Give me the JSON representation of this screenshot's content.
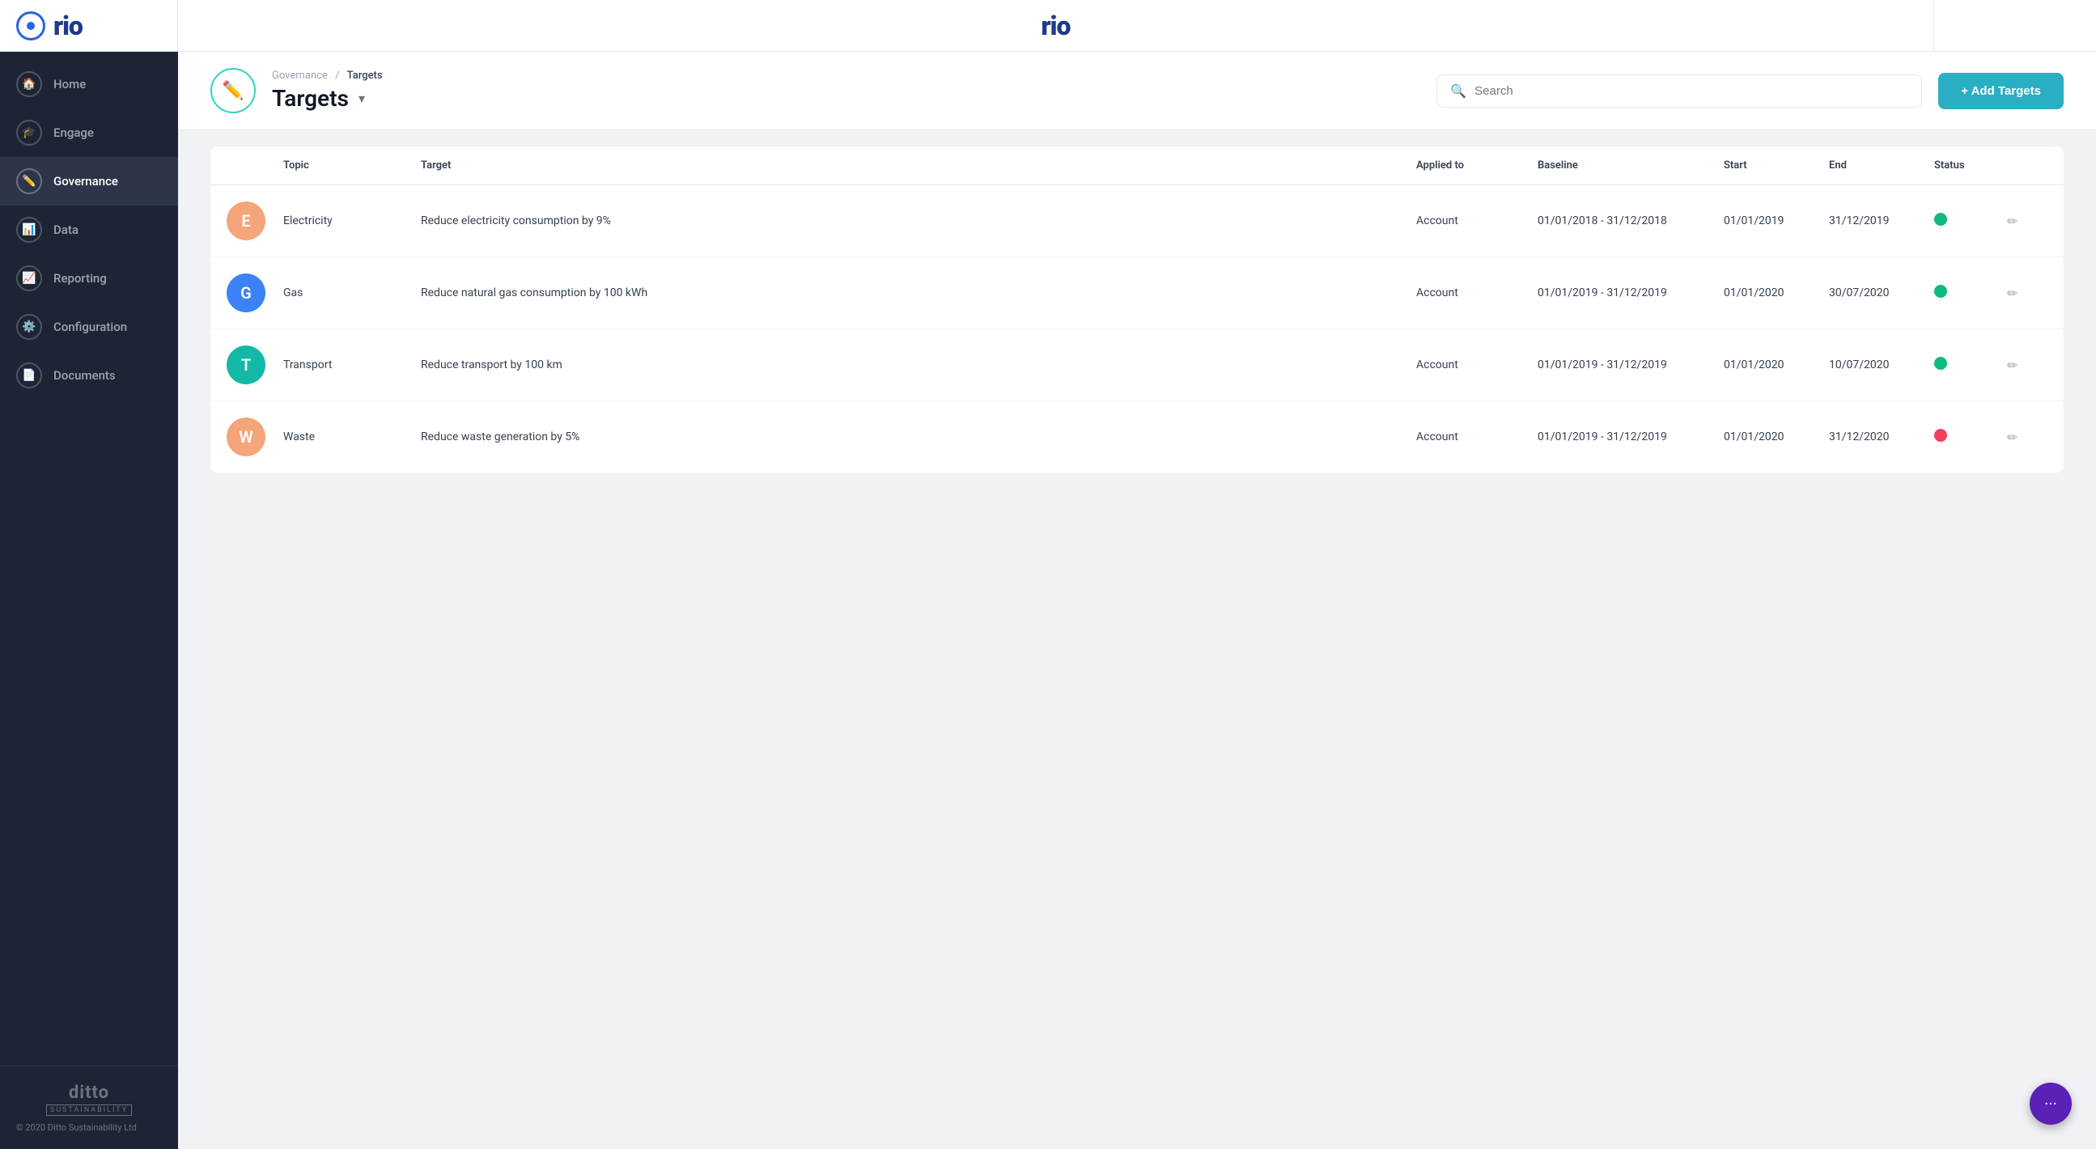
{
  "header": {
    "logo_text": "rio",
    "center_logo": "rio"
  },
  "sidebar": {
    "items": [
      {
        "id": "home",
        "label": "Home",
        "icon": "🏠",
        "active": false
      },
      {
        "id": "engage",
        "label": "Engage",
        "icon": "🎓",
        "active": false
      },
      {
        "id": "governance",
        "label": "Governance",
        "icon": "✏️",
        "active": true
      },
      {
        "id": "data",
        "label": "Data",
        "icon": "📊",
        "active": false
      },
      {
        "id": "reporting",
        "label": "Reporting",
        "icon": "📈",
        "active": false
      },
      {
        "id": "configuration",
        "label": "Configuration",
        "icon": "⚙️",
        "active": false
      },
      {
        "id": "documents",
        "label": "Documents",
        "icon": "📄",
        "active": false
      }
    ],
    "footer": {
      "brand": "ditto",
      "sub": "SUSTAINABILITY",
      "copyright": "© 2020 Ditto Sustainability Ltd"
    }
  },
  "page": {
    "breadcrumb_parent": "Governance",
    "breadcrumb_sep": "/",
    "breadcrumb_current": "Targets",
    "title": "Targets",
    "icon": "✏️",
    "search_placeholder": "Search",
    "add_button_label": "+ Add Targets"
  },
  "table": {
    "columns": [
      {
        "id": "avatar",
        "label": ""
      },
      {
        "id": "topic",
        "label": "Topic"
      },
      {
        "id": "target",
        "label": "Target"
      },
      {
        "id": "applied_to",
        "label": "Applied to"
      },
      {
        "id": "baseline",
        "label": "Baseline"
      },
      {
        "id": "start",
        "label": "Start"
      },
      {
        "id": "end",
        "label": "End"
      },
      {
        "id": "status",
        "label": "Status"
      },
      {
        "id": "actions",
        "label": ""
      }
    ],
    "rows": [
      {
        "avatar_letter": "E",
        "avatar_color": "#f4a57a",
        "topic": "Electricity",
        "target": "Reduce electricity consumption by 9%",
        "applied_to": "Account",
        "baseline": "01/01/2018 - 31/12/2018",
        "start": "01/01/2019",
        "end": "31/12/2019",
        "status_color": "#10b981",
        "status_type": "green"
      },
      {
        "avatar_letter": "G",
        "avatar_color": "#3b82f6",
        "topic": "Gas",
        "target": "Reduce natural gas consumption by 100 kWh",
        "applied_to": "Account",
        "baseline": "01/01/2019 - 31/12/2019",
        "start": "01/01/2020",
        "end": "30/07/2020",
        "status_color": "#10b981",
        "status_type": "green"
      },
      {
        "avatar_letter": "T",
        "avatar_color": "#14b8a6",
        "topic": "Transport",
        "target": "Reduce transport by 100 km",
        "applied_to": "Account",
        "baseline": "01/01/2019 - 31/12/2019",
        "start": "01/01/2020",
        "end": "10/07/2020",
        "status_color": "#10b981",
        "status_type": "green"
      },
      {
        "avatar_letter": "W",
        "avatar_color": "#f4a57a",
        "topic": "Waste",
        "target": "Reduce waste generation by 5%",
        "applied_to": "Account",
        "baseline": "01/01/2019 - 31/12/2019",
        "start": "01/01/2020",
        "end": "31/12/2020",
        "status_color": "#f43f5e",
        "status_type": "red"
      }
    ]
  }
}
